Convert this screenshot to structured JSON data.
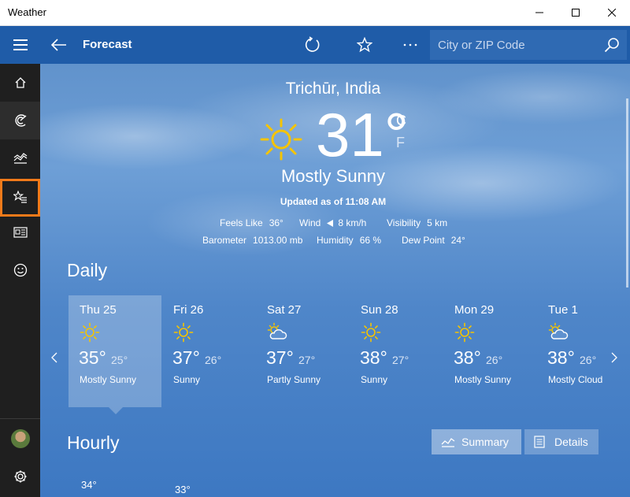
{
  "window": {
    "title": "Weather"
  },
  "topbar": {
    "title": "Forecast",
    "search_placeholder": "City or ZIP Code"
  },
  "current": {
    "city": "Trichūr, India",
    "temp": "31°",
    "unit_c": "C",
    "unit_f": "F",
    "condition": "Mostly Sunny",
    "updated": "Updated as of 11:08 AM",
    "feels_like_label": "Feels Like",
    "feels_like": "36°",
    "wind_label": "Wind",
    "wind": "8 km/h",
    "visibility_label": "Visibility",
    "visibility": "5 km",
    "barometer_label": "Barometer",
    "barometer": "1013.00 mb",
    "humidity_label": "Humidity",
    "humidity": "66 %",
    "dewpoint_label": "Dew Point",
    "dewpoint": "24°"
  },
  "daily": {
    "heading": "Daily",
    "days": [
      {
        "name": "Thu 25",
        "hi": "35°",
        "lo": "25°",
        "cond": "Mostly Sunny",
        "icon": "sun-icon"
      },
      {
        "name": "Fri 26",
        "hi": "37°",
        "lo": "26°",
        "cond": "Sunny",
        "icon": "sun-icon"
      },
      {
        "name": "Sat 27",
        "hi": "37°",
        "lo": "27°",
        "cond": "Partly Sunny",
        "icon": "partly-sunny-icon"
      },
      {
        "name": "Sun 28",
        "hi": "38°",
        "lo": "27°",
        "cond": "Sunny",
        "icon": "sun-icon"
      },
      {
        "name": "Mon 29",
        "hi": "38°",
        "lo": "26°",
        "cond": "Mostly Sunny",
        "icon": "sun-icon"
      },
      {
        "name": "Tue 1",
        "hi": "38°",
        "lo": "26°",
        "cond": "Mostly Cloud",
        "icon": "partly-sunny-icon"
      }
    ]
  },
  "hourly": {
    "heading": "Hourly",
    "summary_label": "Summary",
    "details_label": "Details",
    "temps": [
      "34°",
      "33°"
    ]
  },
  "colors": {
    "nav_blue": "#1f5ca8",
    "sun_yellow": "#f5c400",
    "highlight_orange": "#f07a1a"
  }
}
